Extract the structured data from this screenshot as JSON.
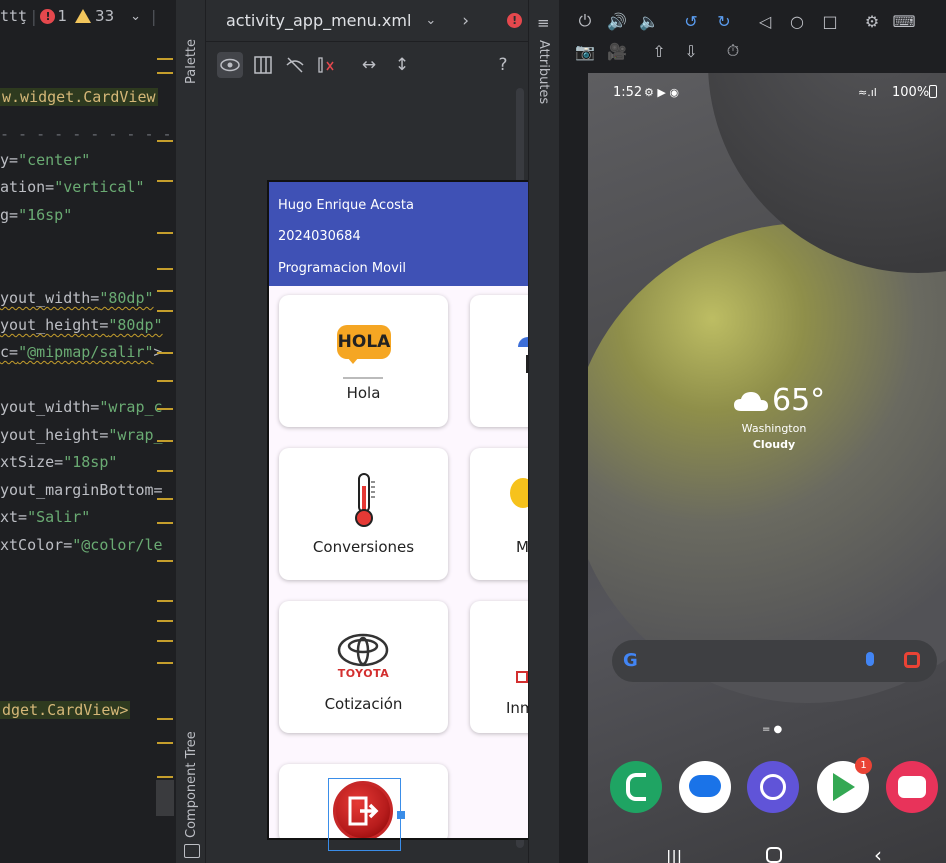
{
  "editor": {
    "top_text": "ttţ",
    "error_count": "1",
    "warning_count": "33",
    "lines": [
      {
        "key": "l1",
        "text": "w.widget.CardView"
      },
      {
        "key": "l2",
        "attr": "y=",
        "val": "\"center\""
      },
      {
        "key": "l3",
        "attr": "ation=",
        "val": "\"vertical\""
      },
      {
        "key": "l4",
        "attr": "g=",
        "val": "\"16sp\""
      },
      {
        "key": "l5",
        "attr": "yout_width=",
        "val": "\"80dp\""
      },
      {
        "key": "l6",
        "attr": "yout_height=",
        "val": "\"80dp\""
      },
      {
        "key": "l7",
        "attr": "c=",
        "val": "\"@mipmap/salir\"",
        "tail": ">"
      },
      {
        "key": "l8",
        "attr": "yout_width=",
        "val": "\"wrap_c"
      },
      {
        "key": "l9",
        "attr": "yout_height=",
        "val": "\"wrap_"
      },
      {
        "key": "l10",
        "attr": "xtSize=",
        "val": "\"18sp\""
      },
      {
        "key": "l11",
        "attr": "yout_marginBottom=",
        "val": ""
      },
      {
        "key": "l12",
        "attr": "xt=",
        "val": "\"Salir\""
      },
      {
        "key": "l13",
        "attr": "xtColor=",
        "val": "\"@color/le"
      },
      {
        "key": "l14",
        "text": "dget.CardView>"
      }
    ]
  },
  "palette_label": "Palette",
  "component_tree_label": "Component Tree",
  "attributes_label": "Attributes",
  "designer": {
    "file_tab": "activity_app_menu.xml",
    "help": "?"
  },
  "app": {
    "header": {
      "name": "Hugo Enrique Acosta",
      "id": "2024030684",
      "course": "Programacion Movil"
    },
    "cards": [
      {
        "label": "Hola",
        "logo_text": "HOLA"
      },
      {
        "label": "Conversiones"
      },
      {
        "label": "Cotización",
        "logo_text": "TOYOTA"
      },
      {
        "label": "Inm"
      },
      {
        "label": "M"
      }
    ]
  },
  "emulator": {
    "time": "1:52",
    "battery": "100%",
    "weather": {
      "temp": "65°",
      "city": "Washington",
      "condition": "Cloudy"
    },
    "play_badge": "1"
  },
  "colors": {
    "app_header": "#3f51b5",
    "error": "#e5484d",
    "warning": "#f2c55c",
    "string": "#6aab73"
  }
}
